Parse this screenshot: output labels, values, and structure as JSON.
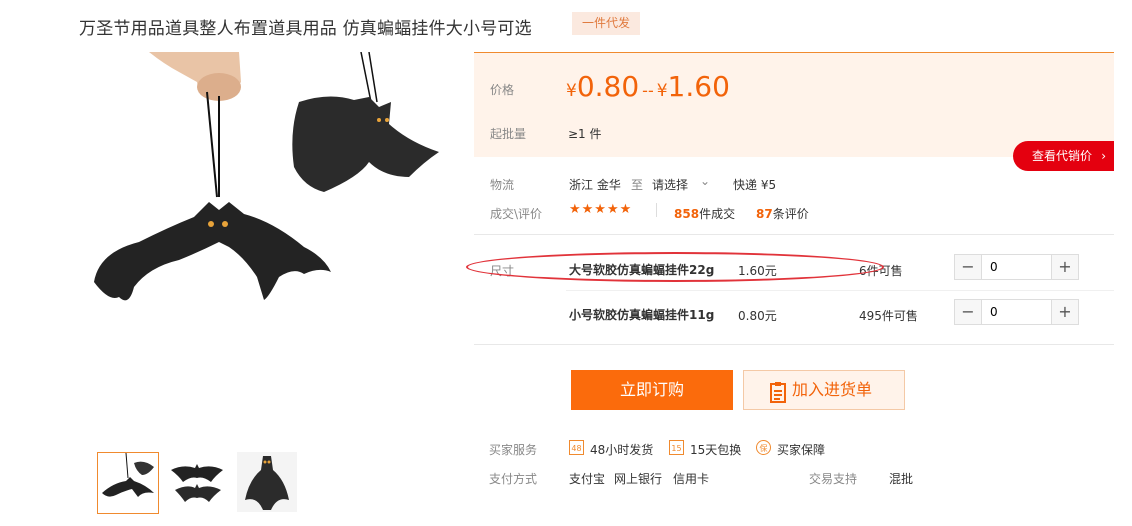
{
  "product": {
    "title": "万圣节用品道具整人布置道具用品 仿真蝙蝠挂件大小号可选",
    "tag": "一件代发"
  },
  "price": {
    "label": "价格",
    "currency": "¥",
    "low": "0.80",
    "separator": "--",
    "high": "1.60",
    "moq_label": "起批量",
    "moq_value": "≥1 件"
  },
  "agent_button": "查看代销价",
  "logistics": {
    "label": "物流",
    "origin": "浙江 金华",
    "to": "至",
    "select": "请选择",
    "shipping": "快递 ¥5"
  },
  "deals": {
    "label": "成交\\评价",
    "stars": "★★★★★",
    "deal_count": "858",
    "deal_suffix": "件成交",
    "review_count": "87",
    "review_suffix": "条评价"
  },
  "sku": {
    "label": "尺寸",
    "items": [
      {
        "name": "大号软胶仿真蝙蝠挂件22g",
        "price": "1.60元",
        "stock": "6",
        "stock_suffix": "件可售",
        "qty": "0"
      },
      {
        "name": "小号软胶仿真蝙蝠挂件11g",
        "price": "0.80元",
        "stock": "495",
        "stock_suffix": "件可售",
        "qty": "0"
      }
    ],
    "minus": "−",
    "plus": "+"
  },
  "actions": {
    "buy": "立即订购",
    "cart": "加入进货单"
  },
  "services": {
    "label": "买家服务",
    "items": [
      {
        "icon": "48",
        "text": "48小时发货"
      },
      {
        "icon": "15",
        "text": "15天包换"
      },
      {
        "icon": "保",
        "text": "买家保障"
      }
    ]
  },
  "payment": {
    "label": "支付方式",
    "methods": [
      "支付宝",
      "网上银行",
      "信用卡"
    ],
    "trade_label": "交易支持",
    "trade_value": "混批"
  },
  "colors": {
    "accent": "#f2630a",
    "buy_button": "#fb6b0c",
    "agent_button": "#e4000f",
    "price_bg": "#fff3ea",
    "annotation": "#e1333a"
  }
}
